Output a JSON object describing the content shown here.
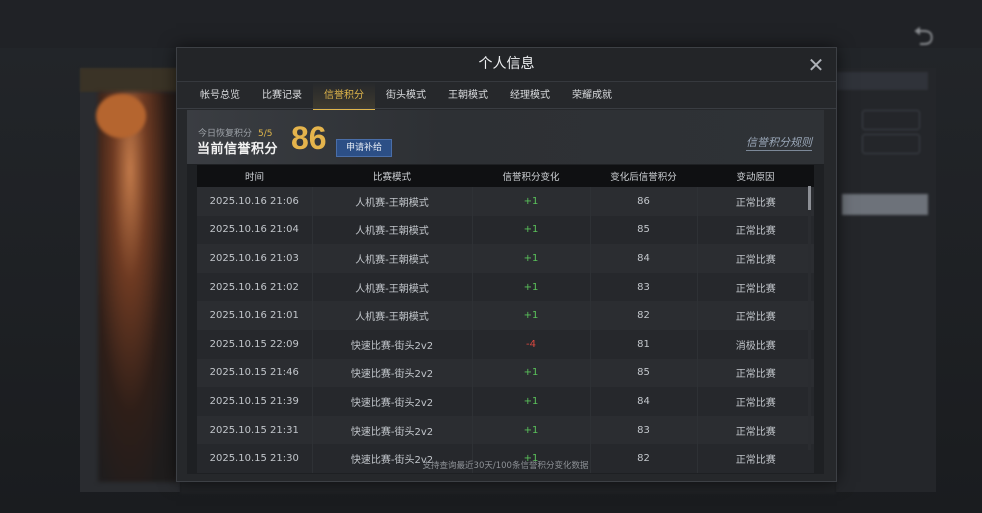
{
  "modal": {
    "title": "个人信息",
    "tabs": [
      {
        "label": "帐号总览"
      },
      {
        "label": "比赛记录"
      },
      {
        "label": "信誉积分",
        "active": true
      },
      {
        "label": "街头模式"
      },
      {
        "label": "王朝模式"
      },
      {
        "label": "经理模式"
      },
      {
        "label": "荣耀成就"
      }
    ]
  },
  "header": {
    "restore_label": "今日恢复积分",
    "restore_value": "5/5",
    "current_label": "当前信誉积分",
    "current_score": "86",
    "apply_button": "申请补给",
    "rules_link": "信誉积分规则"
  },
  "table": {
    "columns": [
      "时间",
      "比赛模式",
      "信誉积分变化",
      "变化后信誉积分",
      "变动原因"
    ],
    "rows": [
      [
        "2025.10.16  21:06",
        "人机赛-王朝模式",
        "+1",
        "86",
        "正常比赛"
      ],
      [
        "2025.10.16  21:04",
        "人机赛-王朝模式",
        "+1",
        "85",
        "正常比赛"
      ],
      [
        "2025.10.16  21:03",
        "人机赛-王朝模式",
        "+1",
        "84",
        "正常比赛"
      ],
      [
        "2025.10.16  21:02",
        "人机赛-王朝模式",
        "+1",
        "83",
        "正常比赛"
      ],
      [
        "2025.10.16  21:01",
        "人机赛-王朝模式",
        "+1",
        "82",
        "正常比赛"
      ],
      [
        "2025.10.15  22:09",
        "快速比赛-街头2v2",
        "-4",
        "81",
        "消极比赛"
      ],
      [
        "2025.10.15  21:46",
        "快速比赛-街头2v2",
        "+1",
        "85",
        "正常比赛"
      ],
      [
        "2025.10.15  21:39",
        "快速比赛-街头2v2",
        "+1",
        "84",
        "正常比赛"
      ],
      [
        "2025.10.15  21:31",
        "快速比赛-街头2v2",
        "+1",
        "83",
        "正常比赛"
      ],
      [
        "2025.10.15  21:30",
        "快速比赛-街头2v2",
        "+1",
        "82",
        "正常比赛"
      ]
    ]
  },
  "footer_note": "支持查询最近30天/100条信誉积分变化数据",
  "colors": {
    "accent": "#e0b64b",
    "positive": "#5ac15a",
    "negative": "#d9473f",
    "button": "#2c4f86"
  }
}
